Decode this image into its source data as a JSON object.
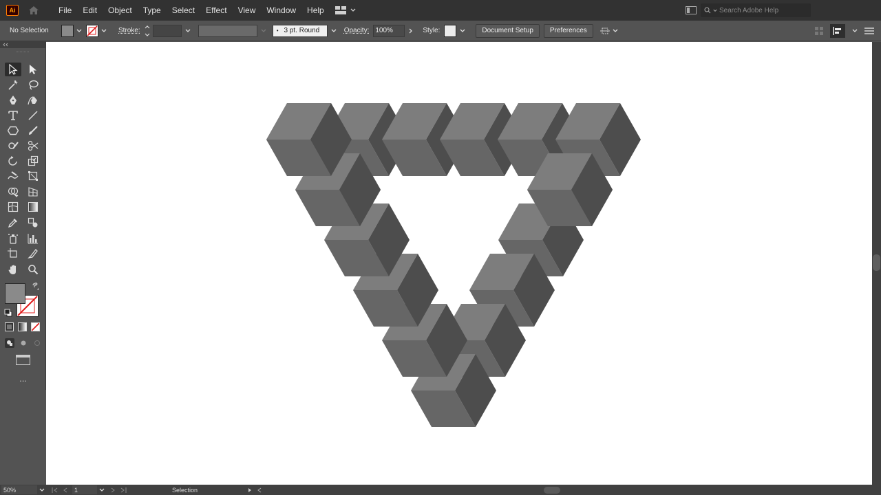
{
  "app": {
    "logo_text": "Ai",
    "accent": "#ff7c00"
  },
  "menu": {
    "items": [
      "File",
      "Edit",
      "Object",
      "Type",
      "Select",
      "Effect",
      "View",
      "Window",
      "Help"
    ]
  },
  "search": {
    "placeholder": "Search Adobe Help"
  },
  "control_bar": {
    "selection_status": "No Selection",
    "stroke_label": "Stroke:",
    "brush_value": "3 pt. Round",
    "opacity_label": "Opacity:",
    "opacity_value": "100%",
    "style_label": "Style:",
    "document_setup_label": "Document Setup",
    "preferences_label": "Preferences",
    "fill_color": "#8a8a8a"
  },
  "tools_panel": {
    "fill_color": "#8a8a8a",
    "more_label": "..."
  },
  "artwork": {
    "face_top": "#7d7d7d",
    "face_left": "#666666",
    "face_right": "#4d4d4d"
  },
  "status_bar": {
    "zoom": "50%",
    "artboard_number": "1",
    "tool_status": "Selection"
  }
}
